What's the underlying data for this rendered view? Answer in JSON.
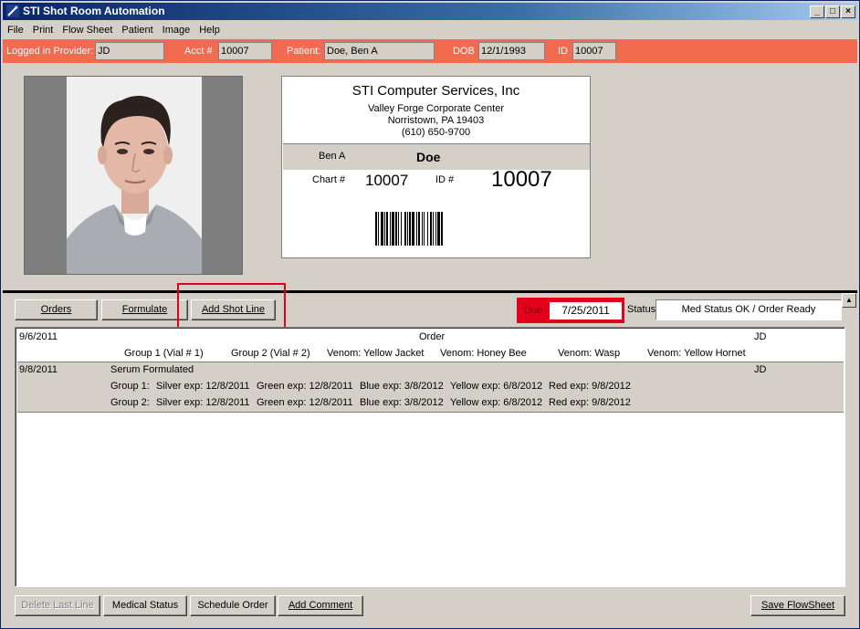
{
  "window": {
    "title": "STI Shot Room Automation"
  },
  "menu": [
    "File",
    "Print",
    "Flow Sheet",
    "Patient",
    "Image",
    "Help"
  ],
  "provider_bar": {
    "provider_label": "Logged in Provider:",
    "provider_value": "JD",
    "acct_label": "Acct #",
    "acct_value": "10007",
    "patient_label": "Patient:",
    "patient_value": "Doe, Ben A",
    "dob_label": "DOB",
    "dob_value": "12/1/1993",
    "id_label": "ID",
    "id_value": "10007"
  },
  "card": {
    "company": "STI Computer Services, Inc",
    "address1": "Valley Forge Corporate Center",
    "address2": "Norristown, PA 19403",
    "phone": "(610) 650-9700",
    "first_name": "Ben A",
    "last_name": "Doe",
    "chart_label": "Chart #",
    "chart_value": "10007",
    "id_label": "ID #",
    "id_value": "10007"
  },
  "toolbar": {
    "orders": "Orders",
    "formulate": "Formulate",
    "add_shot_line": "Add Shot Line",
    "due_label": "Due",
    "due_value": "7/25/2011",
    "status_label": "Status",
    "status_value": "Med Status OK / Order Ready"
  },
  "flowsheet": {
    "order_row": {
      "date": "9/6/2011",
      "title": "Order",
      "provider": "JD"
    },
    "order_detail": [
      "Group 1 (Vial # 1)",
      "Group 2 (Vial # 2)",
      "Venom: Yellow Jacket",
      "Venom: Honey Bee",
      "Venom: Wasp",
      "Venom: Yellow Hornet"
    ],
    "serum_row": {
      "date": "9/8/2011",
      "title": "Serum Formulated",
      "provider": "JD"
    },
    "groups": [
      {
        "label": "Group 1:",
        "items": [
          "Silver exp: 12/8/2011",
          "Green exp: 12/8/2011",
          "Blue exp: 3/8/2012",
          "Yellow exp: 6/8/2012",
          "Red exp: 9/8/2012"
        ]
      },
      {
        "label": "Group 2:",
        "items": [
          "Silver exp: 12/8/2011",
          "Green exp: 12/8/2011",
          "Blue exp: 3/8/2012",
          "Yellow exp: 6/8/2012",
          "Red exp: 9/8/2012"
        ]
      }
    ]
  },
  "bottom": {
    "delete_last_line": "Delete Last Line",
    "medical_status": "Medical Status",
    "schedule_order": "Schedule Order",
    "add_comment": "Add Comment",
    "save_flowsheet": "Save FlowSheet"
  },
  "colors": {
    "provider_bar": "#f26a50",
    "highlight": "#e3001b",
    "title_bar": "#0a246a"
  }
}
